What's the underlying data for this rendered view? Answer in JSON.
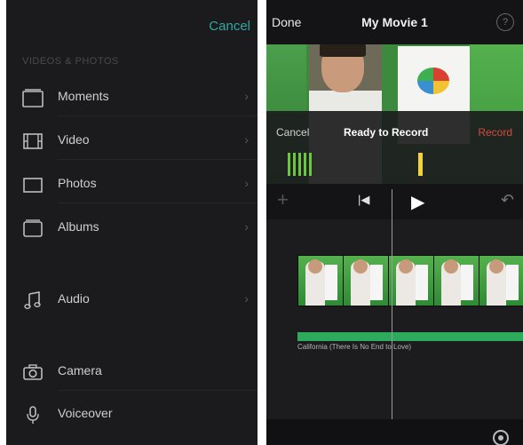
{
  "media_browser": {
    "cancel_label": "Cancel",
    "section_header": "VIDEOS & PHOTOS",
    "items": [
      {
        "label": "Moments",
        "icon": "moments-icon"
      },
      {
        "label": "Video",
        "icon": "film-icon"
      },
      {
        "label": "Photos",
        "icon": "photo-frame-icon"
      },
      {
        "label": "Albums",
        "icon": "album-icon"
      },
      {
        "label": "Audio",
        "icon": "music-note-icon"
      },
      {
        "label": "Camera",
        "icon": "camera-icon"
      },
      {
        "label": "Voiceover",
        "icon": "microphone-icon"
      }
    ]
  },
  "editor": {
    "done_label": "Done",
    "title": "My Movie 1",
    "help_label": "?",
    "record_panel": {
      "cancel_label": "Cancel",
      "status": "Ready to Record",
      "record_label": "Record"
    },
    "audio_track_label": "California (There Is No End to Love)",
    "colors": {
      "accent_teal": "#2fa9a0",
      "record_red": "#d8493d",
      "audio_green": "#2eaa5c",
      "meter_green": "#6cc644",
      "meter_yellow": "#f4d33a"
    }
  }
}
